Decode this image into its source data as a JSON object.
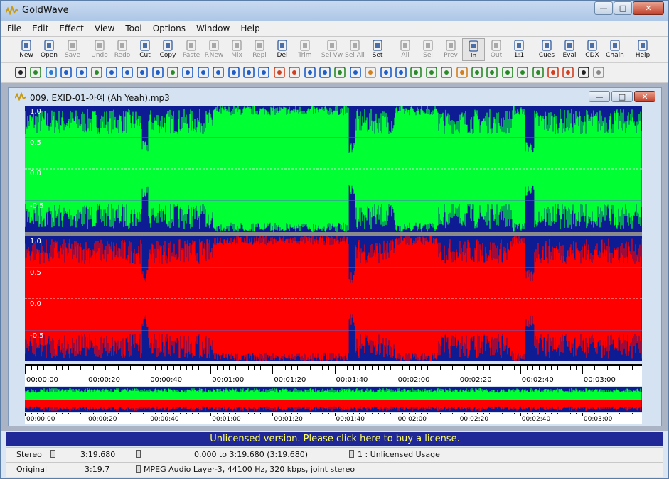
{
  "app": {
    "title": "GoldWave"
  },
  "window_buttons": {
    "minimize": "—",
    "maximize": "□",
    "close": "✕"
  },
  "menu": [
    "File",
    "Edit",
    "Effect",
    "View",
    "Tool",
    "Options",
    "Window",
    "Help"
  ],
  "toolbar": [
    {
      "label": "New",
      "icon": "new-file-icon",
      "enabled": true
    },
    {
      "label": "Open",
      "icon": "open-folder-icon",
      "enabled": true
    },
    {
      "label": "Save",
      "icon": "save-disk-icon",
      "enabled": false
    },
    {
      "label": "Undo",
      "icon": "undo-icon",
      "enabled": false
    },
    {
      "label": "Redo",
      "icon": "redo-icon",
      "enabled": false
    },
    {
      "label": "Cut",
      "icon": "scissors-icon",
      "enabled": true
    },
    {
      "label": "Copy",
      "icon": "copy-icon",
      "enabled": true
    },
    {
      "label": "Paste",
      "icon": "paste-icon",
      "enabled": false
    },
    {
      "label": "P.New",
      "icon": "paste-new-icon",
      "enabled": false
    },
    {
      "label": "Mix",
      "icon": "mix-icon",
      "enabled": false
    },
    {
      "label": "Repl",
      "icon": "replace-icon",
      "enabled": false
    },
    {
      "label": "Del",
      "icon": "delete-icon",
      "enabled": true
    },
    {
      "label": "Trim",
      "icon": "trim-icon",
      "enabled": false
    },
    {
      "label": "Sel Vw",
      "icon": "select-view-icon",
      "enabled": false
    },
    {
      "label": "Sel All",
      "icon": "select-all-icon",
      "enabled": false
    },
    {
      "label": "Set",
      "icon": "set-marker-icon",
      "enabled": true
    },
    {
      "label": "All",
      "icon": "zoom-all-icon",
      "enabled": false
    },
    {
      "label": "Sel",
      "icon": "zoom-selection-icon",
      "enabled": false
    },
    {
      "label": "Prev",
      "icon": "zoom-previous-icon",
      "enabled": false
    },
    {
      "label": "In",
      "icon": "zoom-in-icon",
      "enabled": true
    },
    {
      "label": "Out",
      "icon": "zoom-out-icon",
      "enabled": false
    },
    {
      "label": "1:1",
      "icon": "zoom-one-to-one-icon",
      "enabled": true
    },
    {
      "label": "Cues",
      "icon": "cues-icon",
      "enabled": true
    },
    {
      "label": "Eval",
      "icon": "expression-evaluator-icon",
      "enabled": true
    },
    {
      "label": "CDX",
      "icon": "cd-extract-icon",
      "enabled": true
    },
    {
      "label": "Chain",
      "icon": "effect-chain-icon",
      "enabled": true
    },
    {
      "label": "Help",
      "icon": "help-icon",
      "enabled": true
    }
  ],
  "effects_toolbar": [
    {
      "icon": "auto-gain-icon",
      "color": "#222222"
    },
    {
      "icon": "bandpass-icon",
      "color": "#2a8a2a"
    },
    {
      "icon": "channel-mixer-icon",
      "color": "#2a7ad0"
    },
    {
      "icon": "compressor-icon",
      "color": "#1e5ec8"
    },
    {
      "icon": "doppler-icon",
      "color": "#1e5ec8"
    },
    {
      "icon": "dynamics-icon",
      "color": "#2a8a2a"
    },
    {
      "icon": "echo-icon",
      "color": "#1e5ec8"
    },
    {
      "icon": "equalizer-icon",
      "color": "#1e5ec8"
    },
    {
      "icon": "fade-in-icon",
      "color": "#1e5ec8"
    },
    {
      "icon": "fade-out-icon",
      "color": "#1e5ec8"
    },
    {
      "icon": "filter-icon",
      "color": "#2a8a2a"
    },
    {
      "icon": "flanger-icon",
      "color": "#1e5ec8"
    },
    {
      "icon": "invert-icon",
      "color": "#1e5ec8"
    },
    {
      "icon": "mechanize-icon",
      "color": "#1e5ec8"
    },
    {
      "icon": "offset-icon",
      "color": "#1e5ec8"
    },
    {
      "icon": "pan-icon",
      "color": "#1e5ec8"
    },
    {
      "icon": "pitch-icon",
      "color": "#1e5ec8"
    },
    {
      "icon": "playback-rate-icon",
      "color": "#d04020"
    },
    {
      "icon": "reverb-icon",
      "color": "#d04020"
    },
    {
      "icon": "reverse-icon",
      "color": "#1e5ec8"
    },
    {
      "icon": "silence-icon",
      "color": "#1e5ec8"
    },
    {
      "icon": "spectrum-filter-icon",
      "color": "#2a8a2a"
    },
    {
      "icon": "time-warp-icon",
      "color": "#1e5ec8"
    },
    {
      "icon": "volume-icon",
      "color": "#d08020"
    },
    {
      "icon": "noise-reduction-icon",
      "color": "#1e5ec8"
    },
    {
      "icon": "pop-click-icon",
      "color": "#1e5ec8"
    },
    {
      "icon": "resample-icon",
      "color": "#2a8a2a"
    },
    {
      "icon": "smoother-icon",
      "color": "#2a8a2a"
    },
    {
      "icon": "match-volume-icon",
      "color": "#2a8a2a"
    },
    {
      "icon": "maximize-volume-icon",
      "color": "#d08020"
    },
    {
      "icon": "stereo-icon",
      "color": "#2a8a2a"
    },
    {
      "icon": "voice-icon",
      "color": "#2a8a2a"
    },
    {
      "icon": "play-icon",
      "color": "#1e8a1e"
    },
    {
      "icon": "hz-icon",
      "color": "#2a8a2a"
    },
    {
      "icon": "swap-icon",
      "color": "#2a8a2a"
    },
    {
      "icon": "marker-icon",
      "color": "#d04020"
    },
    {
      "icon": "clip-icon",
      "color": "#d04020"
    },
    {
      "icon": "dial-icon",
      "color": "#222222"
    },
    {
      "icon": "mail-icon",
      "color": "#888888"
    }
  ],
  "document": {
    "title": "009. EXID-01-아예 (Ah Yeah).mp3",
    "channels": [
      {
        "name": "left",
        "color": "#00ff33",
        "ticks": [
          "1.0",
          "0.5",
          "0.0",
          "-0.5"
        ]
      },
      {
        "name": "right",
        "color": "#ff0000",
        "ticks": [
          "1.0",
          "0.5",
          "0.0",
          "-0.5"
        ]
      }
    ],
    "timeline_labels": [
      "00:00:00",
      "00:00:20",
      "00:00:40",
      "00:01:00",
      "00:01:20",
      "00:01:40",
      "00:02:00",
      "00:02:20",
      "00:02:40",
      "00:03:00"
    ]
  },
  "license_banner": "Unlicensed version. Please click here to buy a license.",
  "status": {
    "row1": {
      "channels": "Stereo",
      "length": "3:19.680",
      "selection": "0.000 to 3:19.680 (3:19.680)",
      "message": "1 : Unlicensed Usage"
    },
    "row2": {
      "mode": "Original",
      "length": "3:19.7",
      "format": "MPEG Audio Layer-3, 44100 Hz, 320 kbps, joint stereo"
    }
  },
  "colors": {
    "wave_bg": "#0e1c93",
    "left_channel": "#00ff33",
    "right_channel": "#ff0000",
    "license_text": "#ffff66"
  }
}
